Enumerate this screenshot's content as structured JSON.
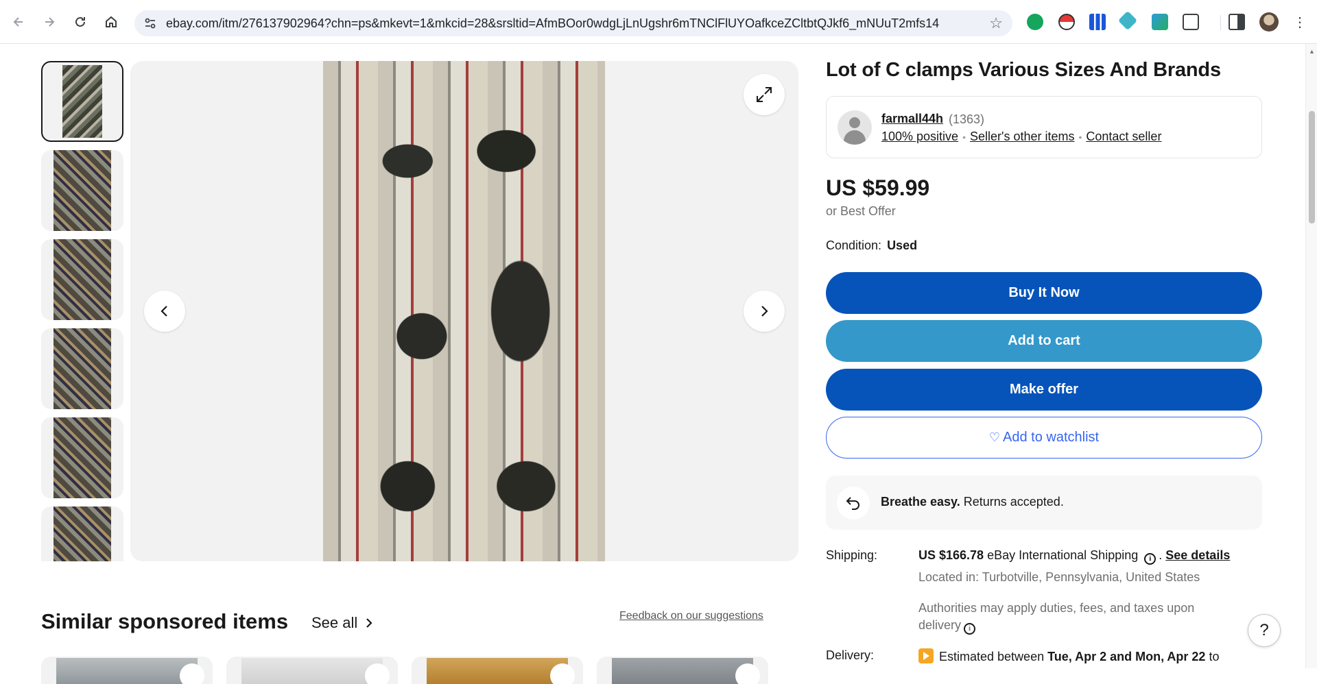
{
  "browser": {
    "url": "ebay.com/itm/276137902964?chn=ps&mkevt=1&mkcid=28&srsltid=AfmBOor0wdgLjLnUgshr6mTNClFlUYOafkceZCltbtQJkf6_mNUuT2mfs14",
    "nav_icons": [
      "back-arrow-icon",
      "forward-arrow-icon",
      "reload-icon",
      "home-icon"
    ],
    "extension_icons": [
      "grammarly-icon",
      "pokeball-icon",
      "analytics-icon",
      "web3-icon",
      "cast-icon",
      "puzzle-icon",
      "sidepanel-icon",
      "profile-avatar"
    ],
    "bookmark_icon": "star-icon"
  },
  "listing": {
    "title": "Lot of C clamps Various Sizes And Brands",
    "seller": {
      "name": "farmall44h",
      "feedback_count": "(1363)",
      "positive": "100% positive",
      "other_items": "Seller's other items",
      "contact": "Contact seller"
    },
    "price": "US $59.99",
    "best_offer": "or Best Offer",
    "condition_label": "Condition:",
    "condition_value": "Used",
    "buttons": {
      "buy_now": "Buy It Now",
      "add_to_cart": "Add to cart",
      "make_offer": "Make offer",
      "watchlist": "Add to watchlist"
    },
    "returns": {
      "bold": "Breathe easy.",
      "text": " Returns accepted."
    },
    "shipping": {
      "label": "Shipping:",
      "amount": "US $166.78",
      "method": " eBay International Shipping",
      "see_details": "See details",
      "located": "Located in: Turbotville, Pennsylvania, United States",
      "duties_line1": "Authorities may apply duties, fees, and taxes upon",
      "duties_line2": "delivery"
    },
    "delivery": {
      "label": "Delivery:",
      "prefix": "Estimated between ",
      "range": "Tue, Apr 2 and Mon, Apr 22",
      "suffix": " to"
    }
  },
  "gallery": {
    "thumbnail_count": 6,
    "selected_index": 0
  },
  "similar": {
    "title": "Similar sponsored items",
    "see_all": "See all",
    "feedback": "Feedback on our suggestions"
  },
  "colors": {
    "primary_blue": "#0654ba",
    "cart_blue": "#3498ca",
    "link_blue": "#3665f3",
    "text": "#191919",
    "muted": "#707070"
  }
}
